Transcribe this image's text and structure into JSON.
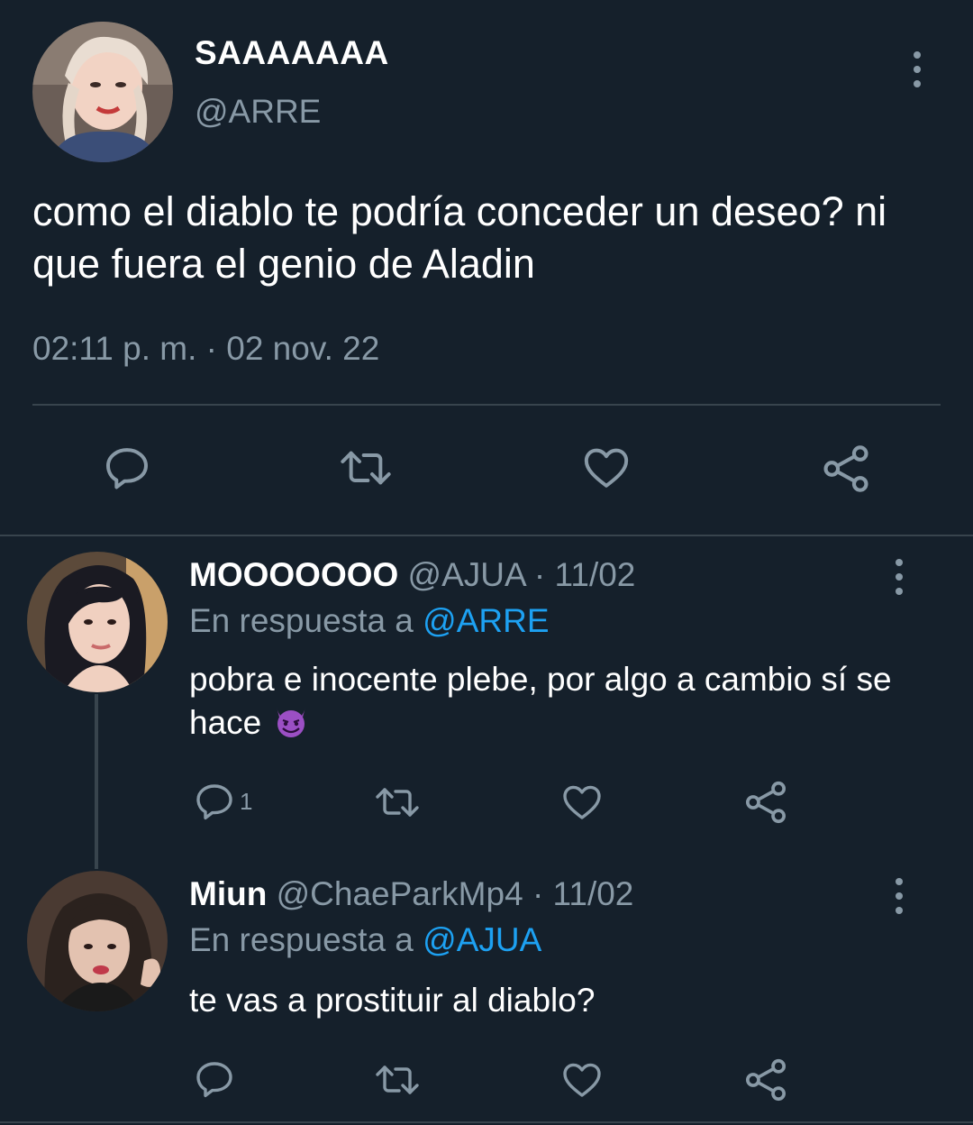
{
  "main_tweet": {
    "name": "SAAAAAAA",
    "handle": "@ARRE",
    "text": "como el diablo te podría conceder un deseo? ni que fuera el genio de Aladin",
    "timestamp": "02:11 p. m. · 02 nov. 22"
  },
  "replies": [
    {
      "name": "MOOOOOOO",
      "meta": " @AJUA · 11/02",
      "replying_label": "En respuesta a ",
      "replying_to": "@ARRE",
      "text": "pobra e inocente plebe, por algo a cambio sí se hace",
      "emoji": "smiling-devil-emoji",
      "reply_count": "1"
    },
    {
      "name": "Miun",
      "meta": " @ChaeParkMp4 · 11/02",
      "replying_label": "En respuesta a ",
      "replying_to": "@AJUA",
      "text": "te vas a prostituir al diablo?"
    }
  ],
  "colors": {
    "background": "#15202b",
    "secondary_text": "#8899a6",
    "mention": "#1da1f2",
    "divider": "#38444d"
  },
  "icons": [
    "reply-icon",
    "retweet-icon",
    "like-icon",
    "share-icon",
    "more-options-icon"
  ]
}
